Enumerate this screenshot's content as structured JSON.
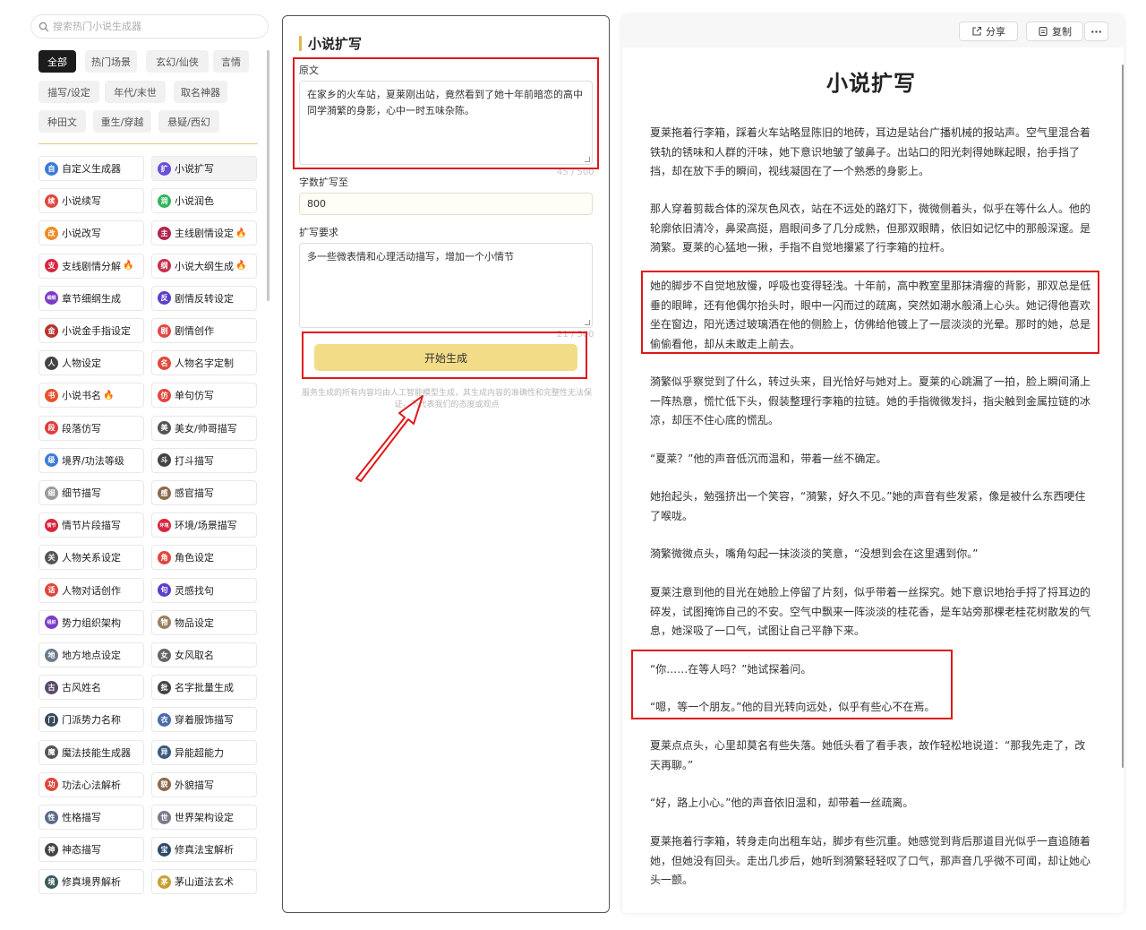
{
  "sidebar": {
    "search_placeholder": "搜索热门小说生成器",
    "categories": [
      "全部",
      "热门场景",
      "玄幻/仙侠",
      "言情",
      "描写/设定",
      "年代/末世",
      "取名神器",
      "种田文",
      "重生/穿越",
      "悬疑/西幻"
    ],
    "tools": [
      {
        "label": "自定义生成器",
        "icon": "自",
        "color": "#3a7bd5",
        "hot": false
      },
      {
        "label": "小说扩写",
        "icon": "扩",
        "color": "#6b4fd8",
        "hot": false
      },
      {
        "label": "小说续写",
        "icon": "续",
        "color": "#e0463c",
        "hot": false
      },
      {
        "label": "小说润色",
        "icon": "润",
        "color": "#2fb55a",
        "hot": false
      },
      {
        "label": "小说改写",
        "icon": "改",
        "color": "#f08a24",
        "hot": false
      },
      {
        "label": "主线剧情设定",
        "icon": "主",
        "color": "#b0264a",
        "hot": true
      },
      {
        "label": "支线剧情分解",
        "icon": "支",
        "color": "#d8263f",
        "hot": true
      },
      {
        "label": "小说大纲生成",
        "icon": "纲",
        "color": "#c82f4a",
        "hot": true
      },
      {
        "label": "章节细纲生成",
        "icon": "细纲",
        "color": "#7a3cc8",
        "hot": false
      },
      {
        "label": "剧情反转设定",
        "icon": "反",
        "color": "#5b3fc8",
        "hot": false
      },
      {
        "label": "小说金手指设定",
        "icon": "金",
        "color": "#b8332e",
        "hot": false
      },
      {
        "label": "剧情创作",
        "icon": "剧",
        "color": "#e04848",
        "hot": false
      },
      {
        "label": "人物设定",
        "icon": "人",
        "color": "#444444",
        "hot": false
      },
      {
        "label": "人物名字定制",
        "icon": "名",
        "color": "#e04a3a",
        "hot": false
      },
      {
        "label": "小说书名",
        "icon": "书",
        "color": "#e8502e",
        "hot": true
      },
      {
        "label": "单句仿写",
        "icon": "仿",
        "color": "#e0463c",
        "hot": false
      },
      {
        "label": "段落仿写",
        "icon": "段",
        "color": "#e03c3c",
        "hot": false
      },
      {
        "label": "美女/帅哥描写",
        "icon": "美",
        "color": "#555555",
        "hot": false
      },
      {
        "label": "境界/功法等级",
        "icon": "级",
        "color": "#3a7bd5",
        "hot": false
      },
      {
        "label": "打斗描写",
        "icon": "斗",
        "color": "#444444",
        "hot": false
      },
      {
        "label": "细节描写",
        "icon": "细",
        "color": "#9a9a9a",
        "hot": false
      },
      {
        "label": "感官描写",
        "icon": "感",
        "color": "#8a6a4a",
        "hot": false
      },
      {
        "label": "情节片段描写",
        "icon": "情节",
        "color": "#d8263f",
        "hot": false
      },
      {
        "label": "环境/场景描写",
        "icon": "环境",
        "color": "#d8263f",
        "hot": false
      },
      {
        "label": "人物关系设定",
        "icon": "关",
        "color": "#555555",
        "hot": false
      },
      {
        "label": "角色设定",
        "icon": "角",
        "color": "#e0463c",
        "hot": false
      },
      {
        "label": "人物对话创作",
        "icon": "话",
        "color": "#e0463c",
        "hot": false
      },
      {
        "label": "灵感找句",
        "icon": "句",
        "color": "#5b3fc8",
        "hot": false
      },
      {
        "label": "势力组织架构",
        "icon": "组织",
        "color": "#7a3cc8",
        "hot": false
      },
      {
        "label": "物品设定",
        "icon": "物",
        "color": "#9a8060",
        "hot": false
      },
      {
        "label": "地方地点设定",
        "icon": "地",
        "color": "#6a7a8a",
        "hot": false
      },
      {
        "label": "女风取名",
        "icon": "女",
        "color": "#666666",
        "hot": false
      },
      {
        "label": "古风姓名",
        "icon": "古",
        "color": "#5a4a6a",
        "hot": false
      },
      {
        "label": "名字批量生成",
        "icon": "批",
        "color": "#444444",
        "hot": false
      },
      {
        "label": "门派势力名称",
        "icon": "门",
        "color": "#3a4a5a",
        "hot": false
      },
      {
        "label": "穿着服饰描写",
        "icon": "衣",
        "color": "#4a6aaa",
        "hot": false
      },
      {
        "label": "魔法技能生成器",
        "icon": "魔",
        "color": "#555555",
        "hot": false
      },
      {
        "label": "异能超能力",
        "icon": "异",
        "color": "#3a5a7a",
        "hot": false
      },
      {
        "label": "功法心法解析",
        "icon": "功",
        "color": "#e0463c",
        "hot": false
      },
      {
        "label": "外貌描写",
        "icon": "貌",
        "color": "#8a6a4a",
        "hot": false
      },
      {
        "label": "性格描写",
        "icon": "性",
        "color": "#5a6a8a",
        "hot": false
      },
      {
        "label": "世界架构设定",
        "icon": "世",
        "color": "#7a7a8a",
        "hot": false
      },
      {
        "label": "神态描写",
        "icon": "神",
        "color": "#444444",
        "hot": false
      },
      {
        "label": "修真法宝解析",
        "icon": "宝",
        "color": "#2a4a6a",
        "hot": false
      },
      {
        "label": "修真境界解析",
        "icon": "境",
        "color": "#3a5a5a",
        "hot": false
      },
      {
        "label": "茅山道法玄术",
        "icon": "茅",
        "color": "#c8a030",
        "hot": false
      }
    ]
  },
  "form": {
    "title": "小说扩写",
    "original_label": "原文",
    "original_text": "在家乡的火车站，夏莱刚出站，竟然看到了她十年前暗恋的高中同学漪繁的身影，心中一时五味杂陈。",
    "original_counter": "45 / 500",
    "wordcount_label": "字数扩写至",
    "wordcount_value": "800",
    "requirement_label": "扩写要求",
    "requirement_text": "多一些微表情和心理活动描写，增加一个小情节",
    "requirement_counter": "21 / 500",
    "generate_label": "开始生成",
    "disclaimer": "服务生成的所有内容均由人工智能模型生成，其生成内容的准确性和完整性无法保证，不代表我们的态度或观点"
  },
  "output": {
    "share_label": "分享",
    "copy_label": "复制",
    "more_label": "···",
    "title": "小说扩写",
    "paragraphs": [
      "夏莱拖着行李箱，踩着火车站略显陈旧的地砖，耳边是站台广播机械的报站声。空气里混合着铁轨的锈味和人群的汗味，她下意识地皱了皱鼻子。出站口的阳光刺得她眯起眼，抬手挡了挡，却在放下手的瞬间，视线凝固在了一个熟悉的身影上。",
      "那人穿着剪裁合体的深灰色风衣，站在不远处的路灯下，微微侧着头，似乎在等什么人。他的轮廓依旧清冷，鼻梁高挺，眉眼间多了几分成熟，但那双眼睛，依旧如记忆中的那般深邃。是漪繁。夏莱的心猛地一揪，手指不自觉地攥紧了行李箱的拉杆。",
      "她的脚步不自觉地放慢，呼吸也变得轻浅。十年前，高中教室里那抹清瘦的背影，那双总是低垂的眼眸，还有他偶尔抬头时，眼中一闪而过的疏离，突然如潮水般涌上心头。她记得他喜欢坐在窗边，阳光透过玻璃洒在他的侧脸上，仿佛给他镀上了一层淡淡的光晕。那时的她，总是偷偷看他，却从未敢走上前去。",
      "漪繁似乎察觉到了什么，转过头来，目光恰好与她对上。夏莱的心跳漏了一拍，脸上瞬间涌上一阵热意，慌忙低下头，假装整理行李箱的拉链。她的手指微微发抖，指尖触到金属拉链的冰凉，却压不住心底的慌乱。",
      "“夏莱？”他的声音低沉而温和，带着一丝不确定。",
      "她抬起头，勉强挤出一个笑容，“漪繁，好久不见。”她的声音有些发紧，像是被什么东西哽住了喉咙。",
      "漪繁微微点头，嘴角勾起一抹淡淡的笑意，“没想到会在这里遇到你。”",
      "夏莱注意到他的目光在她脸上停留了片刻，似乎带着一丝探究。她下意识地抬手捋了捋耳边的碎发，试图掩饰自己的不安。空气中飘来一阵淡淡的桂花香，是车站旁那棵老桂花树散发的气息，她深吸了一口气，试图让自己平静下来。",
      "“你……在等人吗？”她试探着问。",
      "“嗯，等一个朋友。”他的目光转向远处，似乎有些心不在焉。",
      "夏莱点点头，心里却莫名有些失落。她低头看了看手表，故作轻松地说道：“那我先走了，改天再聊。”",
      "“好，路上小心。”他的声音依旧温和，却带着一丝疏离。",
      "夏莱拖着行李箱，转身走向出租车站，脚步有些沉重。她感觉到背后那道目光似乎一直追随着她，但她没有回头。走出几步后，她听到漪繁轻轻叹了口气，那声音几乎微不可闻，却让她心头一颤。"
    ]
  },
  "colors": {
    "accent": "#f2dc88",
    "highlight_box": "#e01818",
    "active_category": "#1c1c1c"
  }
}
